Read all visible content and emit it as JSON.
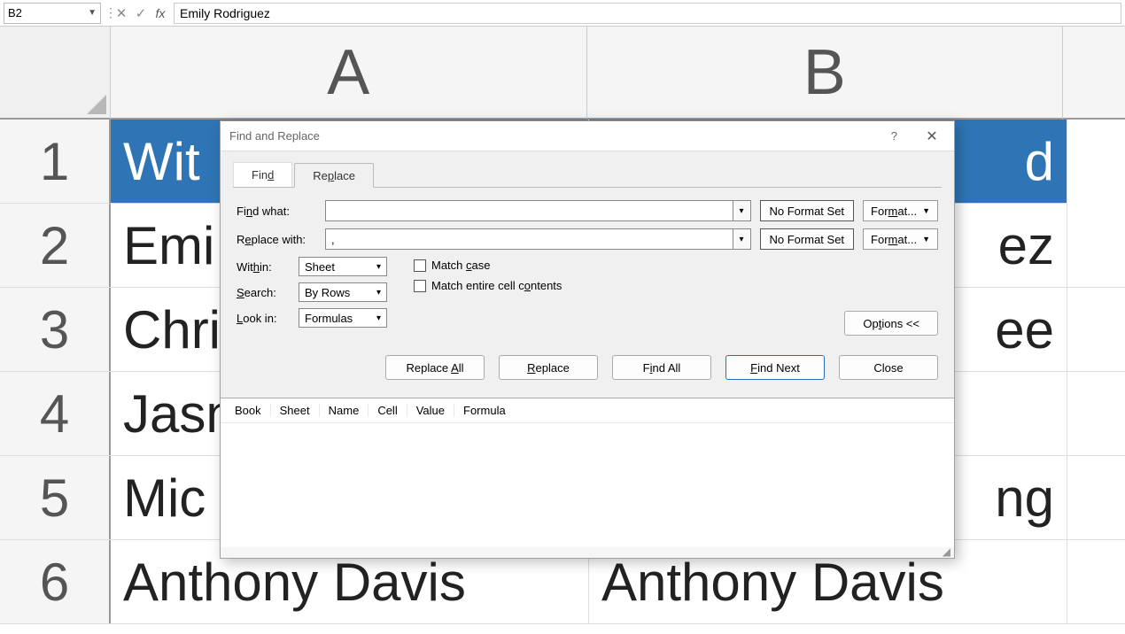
{
  "formula_bar": {
    "name_box": "B2",
    "formula": "Emily Rodriguez"
  },
  "columns": [
    "A",
    "B"
  ],
  "rows": [
    {
      "num": "1",
      "a": "Wit",
      "b": "d"
    },
    {
      "num": "2",
      "a": "Emi",
      "b": "ez"
    },
    {
      "num": "3",
      "a": "Chri",
      "b": "ee"
    },
    {
      "num": "4",
      "a": "Jasn",
      "b": ""
    },
    {
      "num": "5",
      "a": "Mic",
      "b": "ng"
    },
    {
      "num": "6",
      "a": "Anthony Davis",
      "b": "Anthony Davis"
    }
  ],
  "dialog": {
    "title": "Find and Replace",
    "tabs": {
      "find": "Find",
      "replace": "Replace"
    },
    "find_what_label": "Find what:",
    "find_what_value": "",
    "replace_with_label": "Replace with:",
    "replace_with_value": ",",
    "no_format": "No Format Set",
    "format_btn": "Format...",
    "within_label": "Within:",
    "within_value": "Sheet",
    "search_label": "Search:",
    "search_value": "By Rows",
    "lookin_label": "Look in:",
    "lookin_value": "Formulas",
    "match_case": "Match case",
    "match_cell": "Match entire cell contents",
    "options_btn": "Options <<",
    "buttons": {
      "replace_all": "Replace All",
      "replace": "Replace",
      "find_all": "Find All",
      "find_next": "Find Next",
      "close": "Close"
    },
    "results_headers": [
      "Book",
      "Sheet",
      "Name",
      "Cell",
      "Value",
      "Formula"
    ]
  }
}
